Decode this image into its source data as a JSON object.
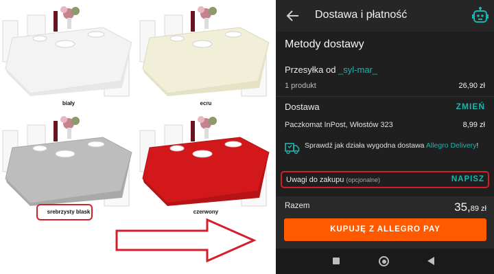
{
  "collage": {
    "variants": [
      {
        "label": "biały",
        "color": "#f3f3f3"
      },
      {
        "label": "ecru",
        "color": "#f2efd9"
      },
      {
        "label": "srebrzysty blask",
        "color": "#bdbdbd"
      },
      {
        "label": "czerwony",
        "color": "#d3181c"
      }
    ],
    "highlight_color": "#d21f2b"
  },
  "phone": {
    "top_title": "Dostawa i płatność",
    "section_title": "Metody dostawy",
    "seller_prefix": "Przesyłka od",
    "seller_name": "_syl-mar_",
    "products_label": "1 produkt",
    "products_value": "26,90 zł",
    "delivery_label": "Dostawa",
    "change_label": "ZMIEŃ",
    "pickup_point": "Paczkomat InPost, Włostów 323",
    "pickup_price": "8,99 zł",
    "promo_text": "Sprawdź jak działa wygodna dostawa",
    "promo_link": "Allegro Delivery",
    "promo_suffix": "!",
    "remarks_label": "Uwagi do zakupu",
    "remarks_optional": "(opcjonalne)",
    "write_label": "NAPISZ",
    "total_label": "Razem",
    "total_main": "35,",
    "total_cents": "89",
    "total_currency": " zł",
    "buy_label": "KUPUJĘ Z ALLEGRO PAY",
    "accent_color": "#19b6b0",
    "buy_color": "#ff5a00"
  }
}
